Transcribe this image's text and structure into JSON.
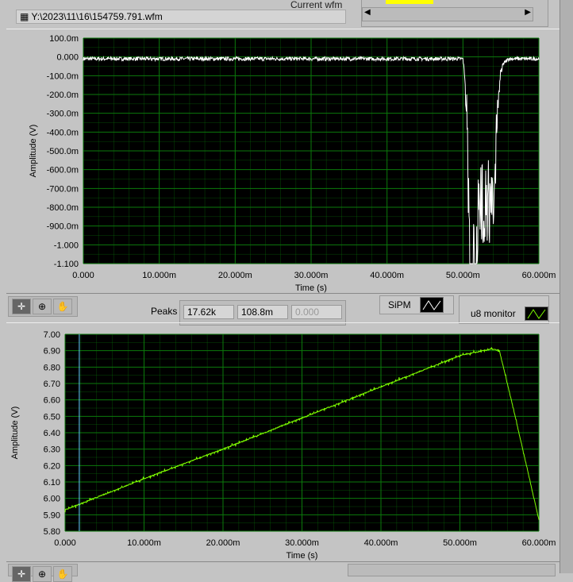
{
  "header": {
    "current_wfm_label": "Current wfm",
    "file_path": "Y:\\2023\\11\\16\\154759.791.wfm"
  },
  "peaks": {
    "label": "Peaks",
    "values": [
      "17.62k",
      "108.8m",
      "0.000"
    ]
  },
  "legend": {
    "sipm": "SiPM",
    "u8": "u8 monitor"
  },
  "colors": {
    "plot_bg": "#000000",
    "grid": "#0b7a0b",
    "sipm_trace": "#ffffff",
    "u8_trace": "#7fff00",
    "cursor": "#66ccff"
  },
  "chart_data": [
    {
      "type": "line",
      "title": "SiPM",
      "xlabel": "Time (s)",
      "ylabel": "Amplitude (V)",
      "xlim": [
        0,
        0.06
      ],
      "ylim": [
        -1.1,
        0.1
      ],
      "x_ticks": [
        "0.000",
        "10.000m",
        "20.000m",
        "30.000m",
        "40.000m",
        "50.000m",
        "60.000m"
      ],
      "y_ticks": [
        "100.0m",
        "0.000",
        "-100.0m",
        "-200.0m",
        "-300.0m",
        "-400.0m",
        "-500.0m",
        "-600.0m",
        "-700.0m",
        "-800.0m",
        "-900.0m",
        "-1.000",
        "-1.100"
      ],
      "series": [
        {
          "name": "SiPM",
          "x": [
            0,
            0.05,
            0.0505,
            0.051,
            0.0515,
            0.052,
            0.053,
            0.054,
            0.0545,
            0.055,
            0.056,
            0.06
          ],
          "y": [
            -0.01,
            -0.01,
            -0.2,
            -1.05,
            -0.85,
            -0.6,
            -0.5,
            -0.6,
            -0.2,
            -0.05,
            -0.01,
            -0.01
          ]
        }
      ]
    },
    {
      "type": "line",
      "title": "u8 monitor",
      "xlabel": "Time (s)",
      "ylabel": "Amplitude (V)",
      "xlim": [
        0,
        0.06
      ],
      "ylim": [
        5.8,
        7.0
      ],
      "x_ticks": [
        "0.000",
        "10.000m",
        "20.000m",
        "30.000m",
        "40.000m",
        "50.000m",
        "60.000m"
      ],
      "y_ticks": [
        "7.00",
        "6.90",
        "6.80",
        "6.70",
        "6.60",
        "6.50",
        "6.40",
        "6.30",
        "6.20",
        "6.10",
        "6.00",
        "5.90",
        "5.80"
      ],
      "cursor_x": 0.0018,
      "series": [
        {
          "name": "u8 monitor",
          "x": [
            0,
            0.01,
            0.02,
            0.03,
            0.04,
            0.05,
            0.054,
            0.055,
            0.057,
            0.06
          ],
          "y": [
            5.93,
            6.12,
            6.3,
            6.49,
            6.68,
            6.87,
            6.91,
            6.9,
            6.5,
            5.87
          ]
        }
      ]
    }
  ]
}
